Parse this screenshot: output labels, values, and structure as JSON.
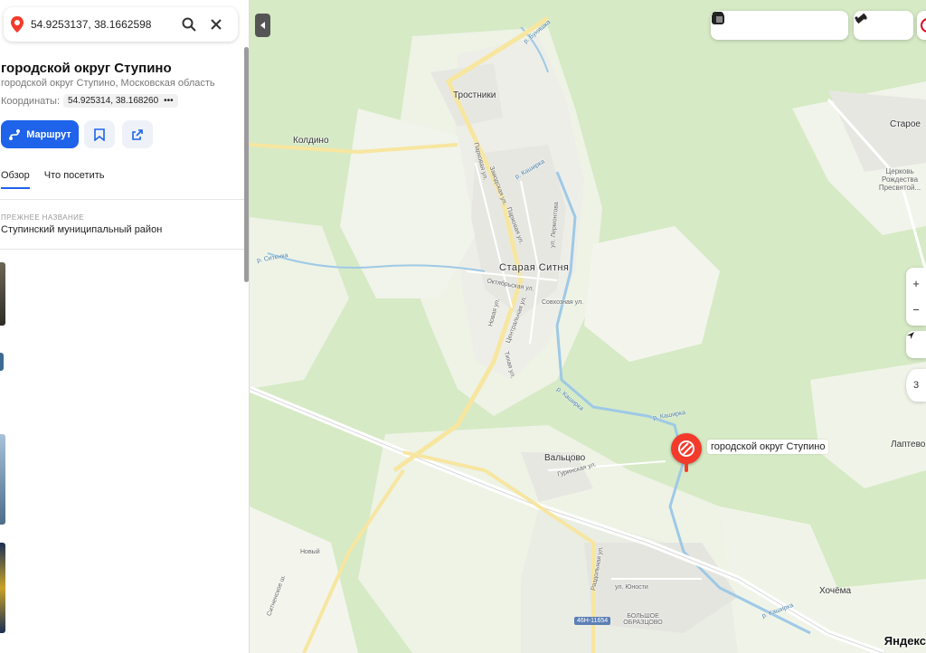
{
  "search": {
    "value": "54.9253137, 38.1662598"
  },
  "place": {
    "title": "городской округ Ступино",
    "subtitle": "городской округ Ступино, Московская область",
    "coords_label": "Координаты:",
    "coords_value": "54.925314, 38.168260",
    "more": "•••"
  },
  "actions": {
    "route_label": "Маршрут"
  },
  "tabs": [
    {
      "label": "Обзор",
      "active": true
    },
    {
      "label": "Что посетить",
      "active": false
    }
  ],
  "former_name": {
    "label": "ПРЕЖНЕЕ НАЗВАНИЕ",
    "value": "Ступинский муниципальный район"
  },
  "map": {
    "pin_label": "городской округ Ступино",
    "zoom_hint": "3",
    "brand": "Яндекс",
    "road_badge": "46Н-11654",
    "labels": {
      "trostniki": "Тростники",
      "koldino": "Колдино",
      "staroe": "Старое",
      "church": "Церковь Рождества Пресвятой...",
      "staraya_sitnya": "Старая Ситня",
      "valtsovo": "Вальцово",
      "laptevo": "Лаптево",
      "hochema": "Хочёма",
      "novy": "Новый",
      "bolshoe": "БОЛЬШОЕ ОБРАЗЦОВО",
      "yunosti": "ул. Юности",
      "razdolnaya": "Раздольная ул.",
      "gurinskaya": "Гуринская ул.",
      "oktyabrskaya": "Октябрьская ул.",
      "sovhoznaya": "Совхозная ул.",
      "centralnaya": "Центральная ул.",
      "novaya": "Новая ул.",
      "tihaya": "Тихая ул.",
      "parkovaya": "Парковая ул.",
      "lermontova": "ул. Лермонтова",
      "dachnaya": "Заводская ул.",
      "parkovaya2": "Парковая ул.",
      "kashirka1": "р. Каширка",
      "kashirka2": "р. Каширка",
      "kashirka3": "р. Каширка",
      "kashirka4": "р. Каширка",
      "sitnya_river": "р. Ситенка",
      "bunkyar": "р. Буняшка",
      "sitnenskoe": "Ситненское ш."
    }
  },
  "colors": {
    "accent": "#1e63e9",
    "pin": "#f33a2b",
    "forest": "#d3e8c1",
    "field": "#f4f6ee",
    "road": "#f7e6a0"
  }
}
